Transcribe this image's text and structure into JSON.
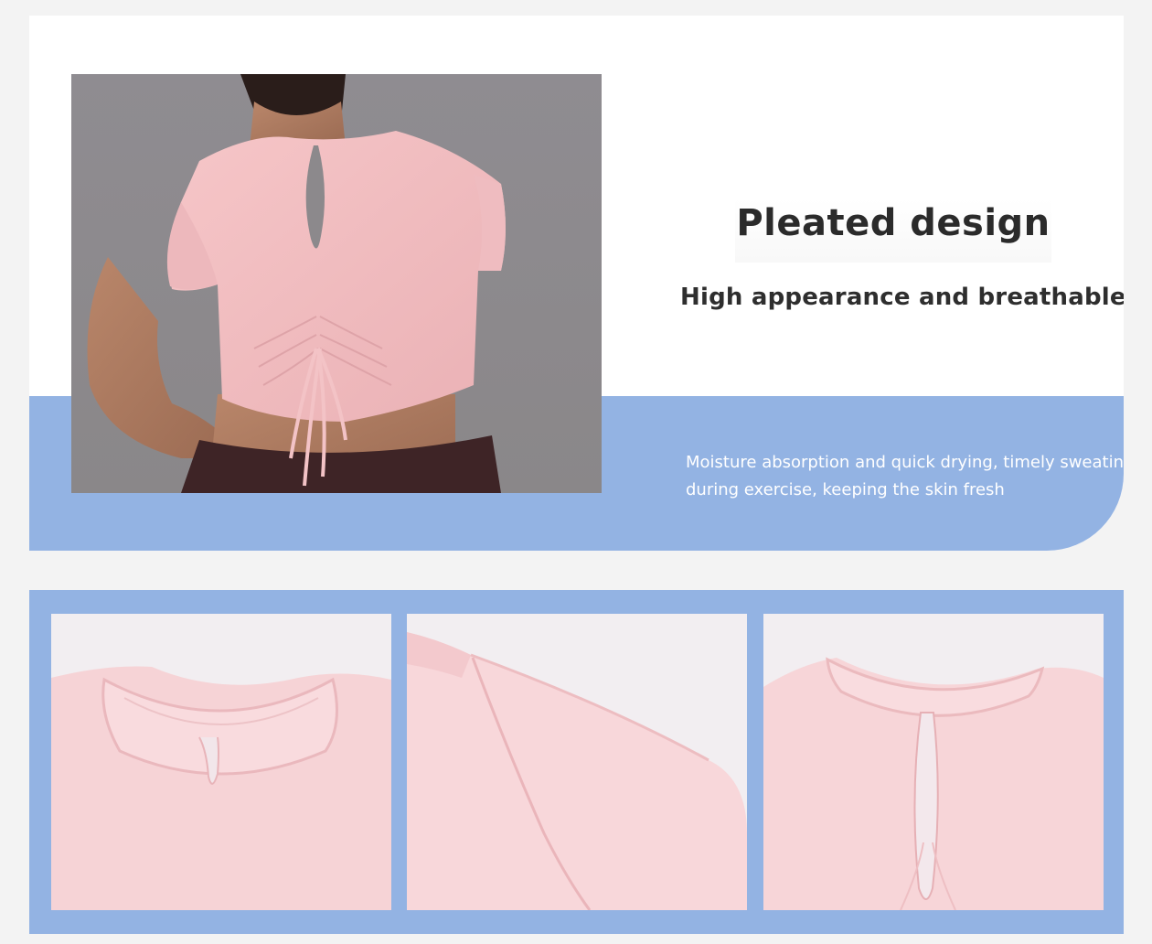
{
  "hero": {
    "title": "Pleated design",
    "subtitle": "High appearance and breathable",
    "description_lines": [
      "Moisture absorption and quick drying, timely sweating",
      "during exercise, keeping the skin fresh"
    ]
  },
  "colors": {
    "page_background": "#f3f3f3",
    "card_background": "#ffffff",
    "accent_blue": "#93b3e3",
    "shirt_pink": "#f6c8cc",
    "title_text": "#2b2b2b",
    "description_text": "#ffffff"
  },
  "images": {
    "hero": "model-back-view-photo",
    "details": [
      "collar-front-detail-photo",
      "shoulder-seam-detail-photo",
      "back-keyhole-detail-photo"
    ]
  }
}
